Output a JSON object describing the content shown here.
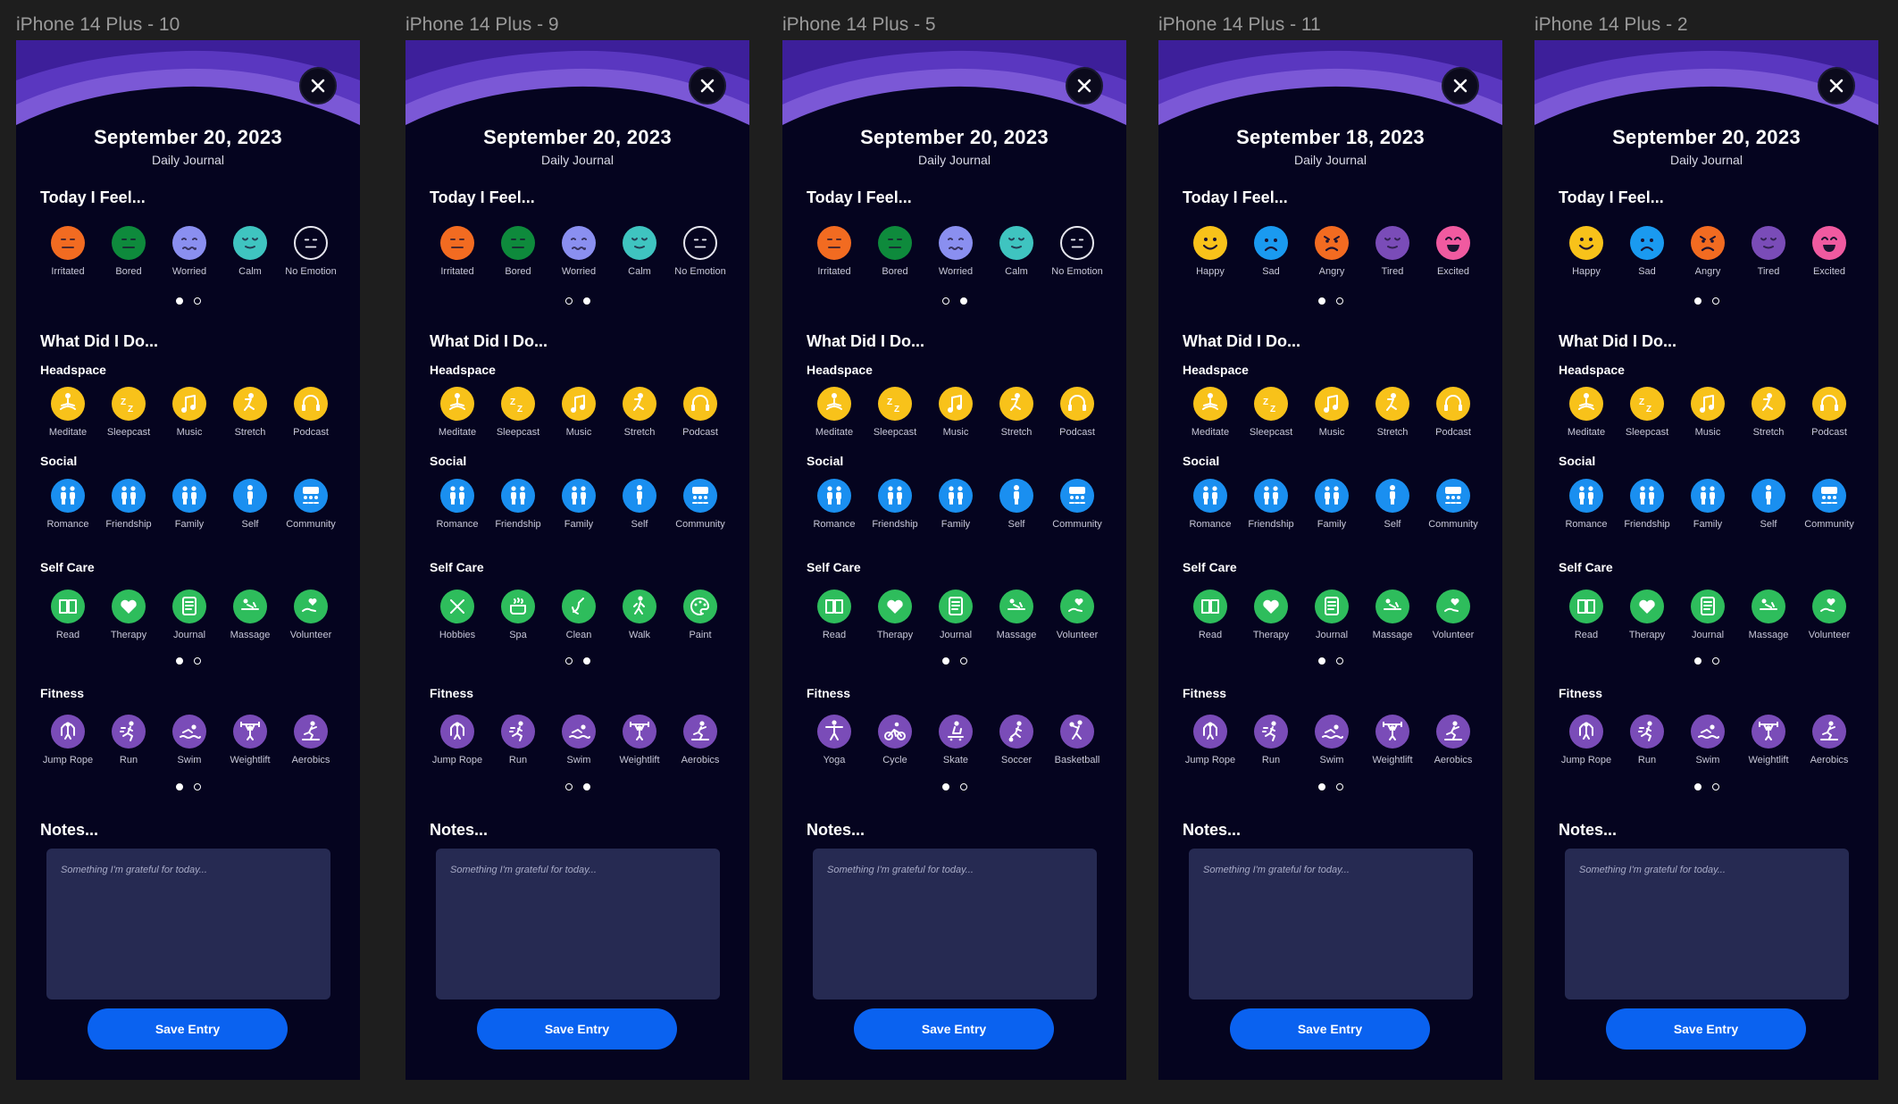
{
  "frames": [
    {
      "label": "iPhone 14 Plus - 10",
      "date": "September 20, 2023",
      "subtitle": "Daily Journal",
      "feel_title": "Today I Feel...",
      "emotions": [
        {
          "label": "Irritated",
          "icon": "irritated-face-icon",
          "color": "#f26b21",
          "face": "flat"
        },
        {
          "label": "Bored",
          "icon": "bored-face-icon",
          "color": "#0e8a3c",
          "face": "flat"
        },
        {
          "label": "Worried",
          "icon": "worried-face-icon",
          "color": "#8a8ff0",
          "face": "wavy"
        },
        {
          "label": "Calm",
          "icon": "calm-face-icon",
          "color": "#3fc4c0",
          "face": "calm"
        },
        {
          "label": "No Emotion",
          "icon": "no-emotion-face-icon",
          "color": "outline",
          "face": "flat"
        }
      ],
      "emotion_page": 0,
      "did_title": "What Did I Do...",
      "categories": [
        {
          "name": "Headspace",
          "color": "#f8c21a",
          "page": 0,
          "items": [
            {
              "label": "Meditate",
              "icon": "meditate-icon"
            },
            {
              "label": "Sleepcast",
              "icon": "sleepcast-icon"
            },
            {
              "label": "Music",
              "icon": "music-icon"
            },
            {
              "label": "Stretch",
              "icon": "stretch-icon"
            },
            {
              "label": "Podcast",
              "icon": "podcast-icon"
            }
          ]
        },
        {
          "name": "Social",
          "color": "#1a8ff0",
          "page": -1,
          "items": [
            {
              "label": "Romance",
              "icon": "romance-icon"
            },
            {
              "label": "Friendship",
              "icon": "friendship-icon"
            },
            {
              "label": "Family",
              "icon": "family-icon"
            },
            {
              "label": "Self",
              "icon": "self-icon"
            },
            {
              "label": "Community",
              "icon": "community-icon"
            }
          ]
        },
        {
          "name": "Self Care",
          "color": "#2ebd5c",
          "page": 0,
          "items": [
            {
              "label": "Read",
              "icon": "read-icon"
            },
            {
              "label": "Therapy",
              "icon": "therapy-icon"
            },
            {
              "label": "Journal",
              "icon": "journal-icon"
            },
            {
              "label": "Massage",
              "icon": "massage-icon"
            },
            {
              "label": "Volunteer",
              "icon": "volunteer-icon"
            }
          ]
        },
        {
          "name": "Fitness",
          "color": "#7a4cb8",
          "page": 0,
          "items": [
            {
              "label": "Jump Rope",
              "icon": "jump-rope-icon"
            },
            {
              "label": "Run",
              "icon": "run-icon"
            },
            {
              "label": "Swim",
              "icon": "swim-icon"
            },
            {
              "label": "Weightlift",
              "icon": "weightlift-icon"
            },
            {
              "label": "Aerobics",
              "icon": "aerobics-icon"
            }
          ]
        }
      ],
      "notes_title": "Notes...",
      "notes_placeholder": "Something I'm grateful for today...",
      "save_label": "Save Entry"
    },
    {
      "label": "iPhone 14 Plus - 9",
      "date": "September 20, 2023",
      "subtitle": "Daily Journal",
      "feel_title": "Today I Feel...",
      "emotions": [
        {
          "label": "Irritated",
          "icon": "irritated-face-icon",
          "color": "#f26b21",
          "face": "flat"
        },
        {
          "label": "Bored",
          "icon": "bored-face-icon",
          "color": "#0e8a3c",
          "face": "flat"
        },
        {
          "label": "Worried",
          "icon": "worried-face-icon",
          "color": "#8a8ff0",
          "face": "wavy"
        },
        {
          "label": "Calm",
          "icon": "calm-face-icon",
          "color": "#3fc4c0",
          "face": "calm"
        },
        {
          "label": "No Emotion",
          "icon": "no-emotion-face-icon",
          "color": "outline",
          "face": "flat"
        }
      ],
      "emotion_page": 1,
      "did_title": "What Did I Do...",
      "categories": [
        {
          "name": "Headspace",
          "color": "#f8c21a",
          "page": 0,
          "items": [
            {
              "label": "Meditate",
              "icon": "meditate-icon"
            },
            {
              "label": "Sleepcast",
              "icon": "sleepcast-icon"
            },
            {
              "label": "Music",
              "icon": "music-icon"
            },
            {
              "label": "Stretch",
              "icon": "stretch-icon"
            },
            {
              "label": "Podcast",
              "icon": "podcast-icon"
            }
          ]
        },
        {
          "name": "Social",
          "color": "#1a8ff0",
          "page": -1,
          "items": [
            {
              "label": "Romance",
              "icon": "romance-icon"
            },
            {
              "label": "Friendship",
              "icon": "friendship-icon"
            },
            {
              "label": "Family",
              "icon": "family-icon"
            },
            {
              "label": "Self",
              "icon": "self-icon"
            },
            {
              "label": "Community",
              "icon": "community-icon"
            }
          ]
        },
        {
          "name": "Self Care",
          "color": "#2ebd5c",
          "page": 1,
          "items": [
            {
              "label": "Hobbies",
              "icon": "hobbies-icon"
            },
            {
              "label": "Spa",
              "icon": "spa-icon"
            },
            {
              "label": "Clean",
              "icon": "clean-icon"
            },
            {
              "label": "Walk",
              "icon": "walk-icon"
            },
            {
              "label": "Paint",
              "icon": "paint-icon"
            }
          ]
        },
        {
          "name": "Fitness",
          "color": "#7a4cb8",
          "page": 1,
          "items": [
            {
              "label": "Jump Rope",
              "icon": "jump-rope-icon"
            },
            {
              "label": "Run",
              "icon": "run-icon"
            },
            {
              "label": "Swim",
              "icon": "swim-icon"
            },
            {
              "label": "Weightlift",
              "icon": "weightlift-icon"
            },
            {
              "label": "Aerobics",
              "icon": "aerobics-icon"
            }
          ]
        }
      ],
      "notes_title": "Notes...",
      "notes_placeholder": "Something I'm grateful for today...",
      "save_label": "Save Entry"
    },
    {
      "label": "iPhone 14 Plus - 5",
      "date": "September 20, 2023",
      "subtitle": "Daily Journal",
      "feel_title": "Today I Feel...",
      "emotions": [
        {
          "label": "Irritated",
          "icon": "irritated-face-icon",
          "color": "#f26b21",
          "face": "flat"
        },
        {
          "label": "Bored",
          "icon": "bored-face-icon",
          "color": "#0e8a3c",
          "face": "flat"
        },
        {
          "label": "Worried",
          "icon": "worried-face-icon",
          "color": "#8a8ff0",
          "face": "wavy"
        },
        {
          "label": "Calm",
          "icon": "calm-face-icon",
          "color": "#3fc4c0",
          "face": "calm"
        },
        {
          "label": "No Emotion",
          "icon": "no-emotion-face-icon",
          "color": "outline",
          "face": "flat"
        }
      ],
      "emotion_page": 1,
      "did_title": "What Did I Do...",
      "categories": [
        {
          "name": "Headspace",
          "color": "#f8c21a",
          "page": 0,
          "items": [
            {
              "label": "Meditate",
              "icon": "meditate-icon"
            },
            {
              "label": "Sleepcast",
              "icon": "sleepcast-icon"
            },
            {
              "label": "Music",
              "icon": "music-icon"
            },
            {
              "label": "Stretch",
              "icon": "stretch-icon"
            },
            {
              "label": "Podcast",
              "icon": "podcast-icon"
            }
          ]
        },
        {
          "name": "Social",
          "color": "#1a8ff0",
          "page": -1,
          "items": [
            {
              "label": "Romance",
              "icon": "romance-icon"
            },
            {
              "label": "Friendship",
              "icon": "friendship-icon"
            },
            {
              "label": "Family",
              "icon": "family-icon"
            },
            {
              "label": "Self",
              "icon": "self-icon"
            },
            {
              "label": "Community",
              "icon": "community-icon"
            }
          ]
        },
        {
          "name": "Self Care",
          "color": "#2ebd5c",
          "page": 0,
          "items": [
            {
              "label": "Read",
              "icon": "read-icon"
            },
            {
              "label": "Therapy",
              "icon": "therapy-icon"
            },
            {
              "label": "Journal",
              "icon": "journal-icon"
            },
            {
              "label": "Massage",
              "icon": "massage-icon"
            },
            {
              "label": "Volunteer",
              "icon": "volunteer-icon"
            }
          ]
        },
        {
          "name": "Fitness",
          "color": "#7a4cb8",
          "page": 0,
          "items": [
            {
              "label": "Yoga",
              "icon": "yoga-icon"
            },
            {
              "label": "Cycle",
              "icon": "cycle-icon"
            },
            {
              "label": "Skate",
              "icon": "skate-icon"
            },
            {
              "label": "Soccer",
              "icon": "soccer-icon"
            },
            {
              "label": "Basketball",
              "icon": "basketball-icon"
            }
          ]
        }
      ],
      "notes_title": "Notes...",
      "notes_placeholder": "Something I'm grateful for today...",
      "save_label": "Save Entry"
    },
    {
      "label": "iPhone 14 Plus - 11",
      "date": "September 18, 2023",
      "subtitle": "Daily Journal",
      "feel_title": "Today I Feel...",
      "emotions": [
        {
          "label": "Happy",
          "icon": "happy-face-icon",
          "color": "#f8c21a",
          "face": "smile"
        },
        {
          "label": "Sad",
          "icon": "sad-face-icon",
          "color": "#1a9af0",
          "face": "frown"
        },
        {
          "label": "Angry",
          "icon": "angry-face-icon",
          "color": "#f26b21",
          "face": "angry"
        },
        {
          "label": "Tired",
          "icon": "tired-face-icon",
          "color": "#7a4cb8",
          "face": "calm"
        },
        {
          "label": "Excited",
          "icon": "excited-face-icon",
          "color": "#f05aa0",
          "face": "grin"
        }
      ],
      "emotion_page": 0,
      "did_title": "What Did I Do...",
      "categories": [
        {
          "name": "Headspace",
          "color": "#f8c21a",
          "page": 0,
          "items": [
            {
              "label": "Meditate",
              "icon": "meditate-icon"
            },
            {
              "label": "Sleepcast",
              "icon": "sleepcast-icon"
            },
            {
              "label": "Music",
              "icon": "music-icon"
            },
            {
              "label": "Stretch",
              "icon": "stretch-icon"
            },
            {
              "label": "Podcast",
              "icon": "podcast-icon"
            }
          ]
        },
        {
          "name": "Social",
          "color": "#1a8ff0",
          "page": -1,
          "items": [
            {
              "label": "Romance",
              "icon": "romance-icon"
            },
            {
              "label": "Friendship",
              "icon": "friendship-icon"
            },
            {
              "label": "Family",
              "icon": "family-icon"
            },
            {
              "label": "Self",
              "icon": "self-icon"
            },
            {
              "label": "Community",
              "icon": "community-icon"
            }
          ]
        },
        {
          "name": "Self Care",
          "color": "#2ebd5c",
          "page": 0,
          "items": [
            {
              "label": "Read",
              "icon": "read-icon"
            },
            {
              "label": "Therapy",
              "icon": "therapy-icon"
            },
            {
              "label": "Journal",
              "icon": "journal-icon"
            },
            {
              "label": "Massage",
              "icon": "massage-icon"
            },
            {
              "label": "Volunteer",
              "icon": "volunteer-icon"
            }
          ]
        },
        {
          "name": "Fitness",
          "color": "#7a4cb8",
          "page": 0,
          "items": [
            {
              "label": "Jump Rope",
              "icon": "jump-rope-icon"
            },
            {
              "label": "Run",
              "icon": "run-icon"
            },
            {
              "label": "Swim",
              "icon": "swim-icon"
            },
            {
              "label": "Weightlift",
              "icon": "weightlift-icon"
            },
            {
              "label": "Aerobics",
              "icon": "aerobics-icon"
            }
          ]
        }
      ],
      "notes_title": "Notes...",
      "notes_placeholder": "Something I'm grateful for today...",
      "save_label": "Save Entry"
    },
    {
      "label": "iPhone 14 Plus - 2",
      "date": "September 20, 2023",
      "subtitle": "Daily Journal",
      "feel_title": "Today I Feel...",
      "emotions": [
        {
          "label": "Happy",
          "icon": "happy-face-icon",
          "color": "#f8c21a",
          "face": "smile"
        },
        {
          "label": "Sad",
          "icon": "sad-face-icon",
          "color": "#1a9af0",
          "face": "frown"
        },
        {
          "label": "Angry",
          "icon": "angry-face-icon",
          "color": "#f26b21",
          "face": "angry"
        },
        {
          "label": "Tired",
          "icon": "tired-face-icon",
          "color": "#7a4cb8",
          "face": "calm"
        },
        {
          "label": "Excited",
          "icon": "excited-face-icon",
          "color": "#f05aa0",
          "face": "grin"
        }
      ],
      "emotion_page": 0,
      "did_title": "What Did I Do...",
      "categories": [
        {
          "name": "Headspace",
          "color": "#f8c21a",
          "page": 0,
          "items": [
            {
              "label": "Meditate",
              "icon": "meditate-icon"
            },
            {
              "label": "Sleepcast",
              "icon": "sleepcast-icon"
            },
            {
              "label": "Music",
              "icon": "music-icon"
            },
            {
              "label": "Stretch",
              "icon": "stretch-icon"
            },
            {
              "label": "Podcast",
              "icon": "podcast-icon"
            }
          ]
        },
        {
          "name": "Social",
          "color": "#1a8ff0",
          "page": -1,
          "items": [
            {
              "label": "Romance",
              "icon": "romance-icon"
            },
            {
              "label": "Friendship",
              "icon": "friendship-icon"
            },
            {
              "label": "Family",
              "icon": "family-icon"
            },
            {
              "label": "Self",
              "icon": "self-icon"
            },
            {
              "label": "Community",
              "icon": "community-icon"
            }
          ]
        },
        {
          "name": "Self Care",
          "color": "#2ebd5c",
          "page": 0,
          "items": [
            {
              "label": "Read",
              "icon": "read-icon"
            },
            {
              "label": "Therapy",
              "icon": "therapy-icon"
            },
            {
              "label": "Journal",
              "icon": "journal-icon"
            },
            {
              "label": "Massage",
              "icon": "massage-icon"
            },
            {
              "label": "Volunteer",
              "icon": "volunteer-icon"
            }
          ]
        },
        {
          "name": "Fitness",
          "color": "#7a4cb8",
          "page": 0,
          "items": [
            {
              "label": "Jump Rope",
              "icon": "jump-rope-icon"
            },
            {
              "label": "Run",
              "icon": "run-icon"
            },
            {
              "label": "Swim",
              "icon": "swim-icon"
            },
            {
              "label": "Weightlift",
              "icon": "weightlift-icon"
            },
            {
              "label": "Aerobics",
              "icon": "aerobics-icon"
            }
          ]
        }
      ],
      "notes_title": "Notes...",
      "notes_placeholder": "Something I'm grateful for today...",
      "save_label": "Save Entry"
    }
  ]
}
